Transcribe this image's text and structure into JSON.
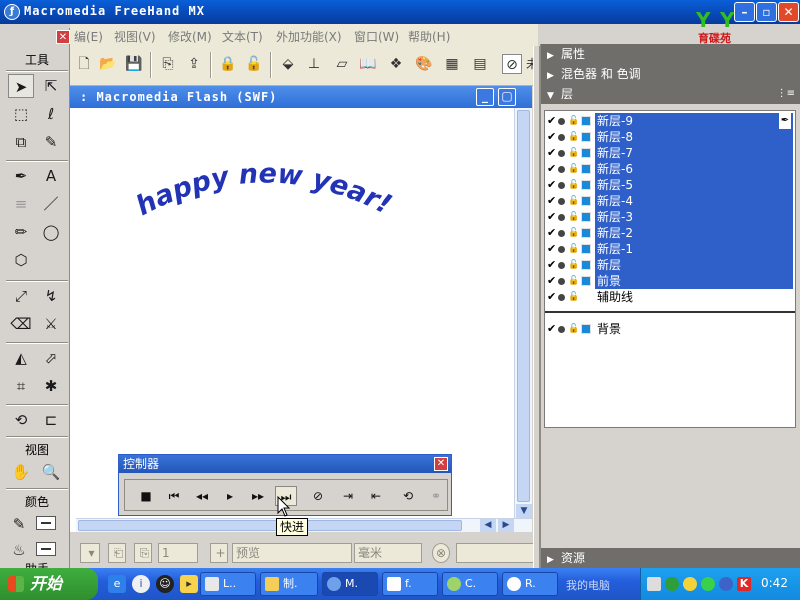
{
  "window": {
    "title": "Macromedia FreeHand MX"
  },
  "logo": {
    "text": "育碟苑"
  },
  "menu": [
    {
      "label": "编(E)"
    },
    {
      "label": "视图(V)"
    },
    {
      "label": "修改(M)"
    },
    {
      "label": "文本(T)"
    },
    {
      "label": "外加功能(X)"
    },
    {
      "label": "窗口(W)"
    },
    {
      "label": "帮助(H)"
    }
  ],
  "toolbar": {
    "partial_label": "未"
  },
  "tools_panel": {
    "title": "工具",
    "view_section": "视图",
    "color_section": "颜色",
    "help_section": "助手"
  },
  "document": {
    "title": ": Macromedia Flash (SWF)",
    "artwork_text": "happy new year!"
  },
  "status": {
    "preview_value": "预览",
    "unit_value": "毫米",
    "page_value": "1"
  },
  "panels": {
    "properties": "属性",
    "mixer": "混色器 和 色调",
    "layers": "层",
    "assets": "资源"
  },
  "layers": [
    {
      "name": "新层-9",
      "selected": true
    },
    {
      "name": "新层-8",
      "selected": true
    },
    {
      "name": "新层-7",
      "selected": true
    },
    {
      "name": "新层-6",
      "selected": true
    },
    {
      "name": "新层-5",
      "selected": true
    },
    {
      "name": "新层-4",
      "selected": true
    },
    {
      "name": "新层-3",
      "selected": true
    },
    {
      "name": "新层-2",
      "selected": true
    },
    {
      "name": "新层-1",
      "selected": true
    },
    {
      "name": "新层",
      "selected": true
    },
    {
      "name": "前景",
      "selected": true
    }
  ],
  "guides_layer": {
    "name": "辅助线"
  },
  "background_layer": {
    "name": "背景"
  },
  "controller": {
    "title": "控制器",
    "tooltip": "快进"
  },
  "taskbar": {
    "start_label": "开始",
    "tasks": [
      {
        "label": "L.."
      },
      {
        "label": "制."
      },
      {
        "label": "M."
      },
      {
        "label": "f."
      },
      {
        "label": "C."
      },
      {
        "label": "R."
      }
    ],
    "my_computer": "我的电脑",
    "clock": "0:42"
  },
  "colors": {
    "selection": "#2f5fc8",
    "layer_swatch": "#1a8ad8",
    "artwork_text": "#2233b5"
  }
}
